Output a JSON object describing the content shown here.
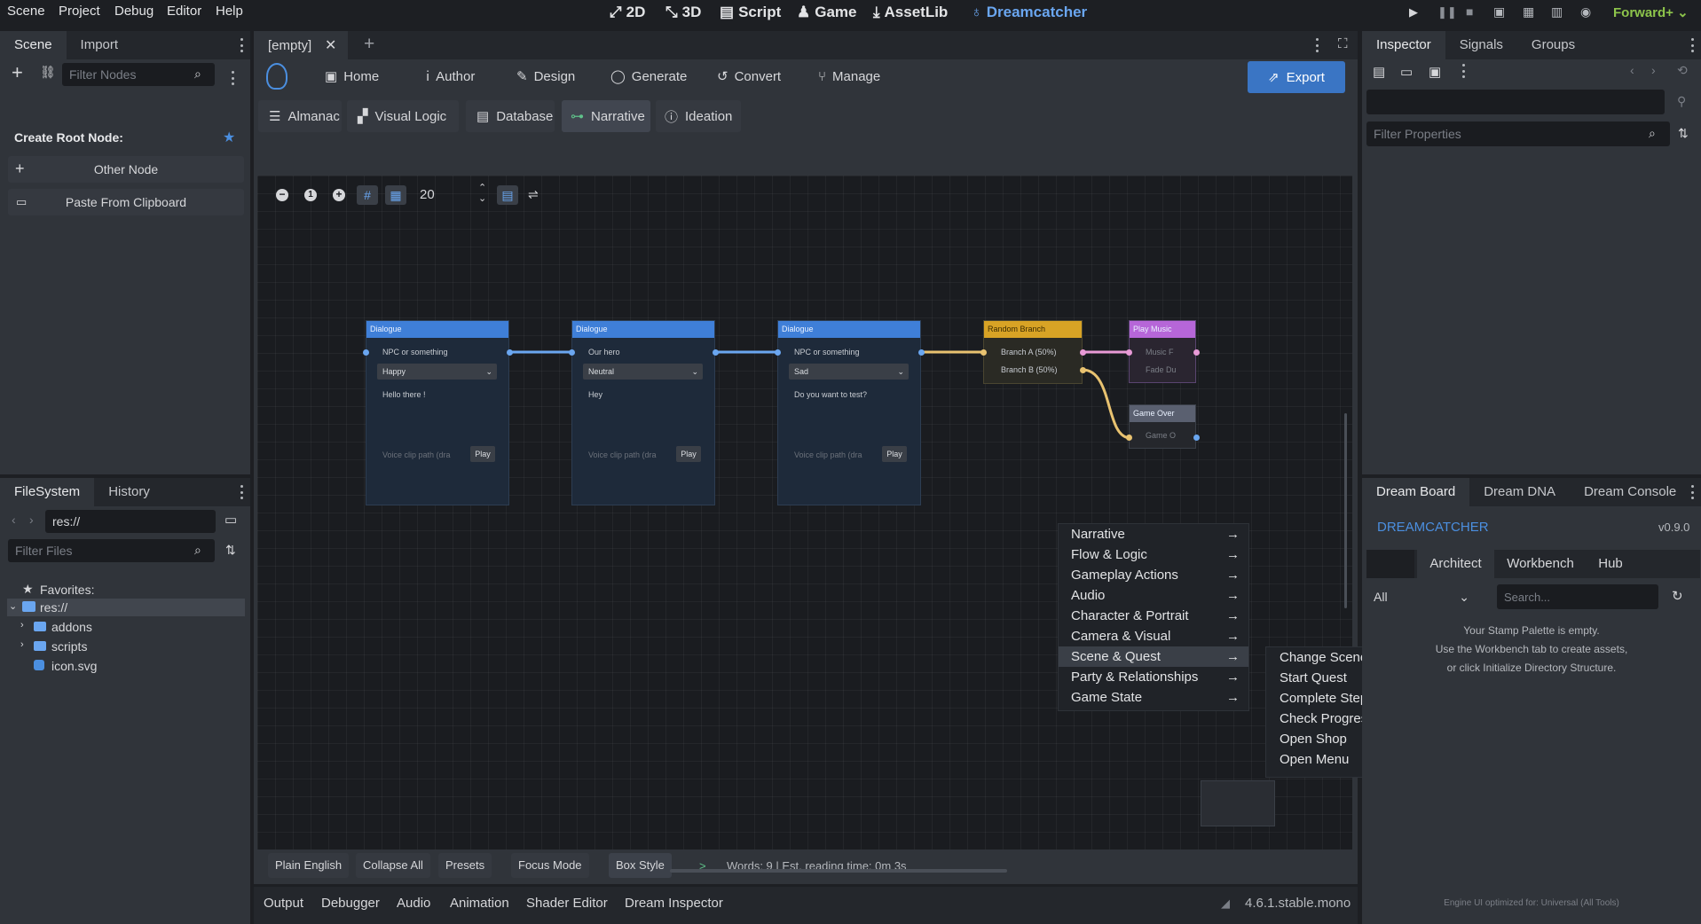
{
  "menu": [
    "Scene",
    "Project",
    "Debug",
    "Editor",
    "Help"
  ],
  "workspaces": {
    "w2d": "2D",
    "w3d": "3D",
    "script": "Script",
    "game": "Game",
    "assetlib": "AssetLib",
    "dreamcatcher": "Dreamcatcher"
  },
  "renderer": "Forward+",
  "scene_dock": {
    "tabs": [
      "Scene",
      "Import"
    ],
    "filter_placeholder": "Filter Nodes",
    "create_root": "Create Root Node:",
    "other_node": "Other Node",
    "paste": "Paste From Clipboard"
  },
  "filesystem": {
    "tabs": [
      "FileSystem",
      "History"
    ],
    "path": "res://",
    "filter_placeholder": "Filter Files",
    "favorites": "Favorites:",
    "root": "res://",
    "items": [
      "addons",
      "scripts",
      "icon.svg"
    ]
  },
  "editor_tab": {
    "name": "[empty]"
  },
  "toolbar": {
    "home": "Home",
    "author": "Author",
    "design": "Design",
    "generate": "Generate",
    "convert": "Convert",
    "manage": "Manage",
    "export": "Export"
  },
  "subtabs": {
    "almanac": "Almanac",
    "visual_logic": "Visual Logic",
    "database": "Database",
    "narrative": "Narrative",
    "ideation": "Ideation"
  },
  "graph": {
    "zoom": "20",
    "dialogues": [
      {
        "title": "Dialogue",
        "speaker": "NPC or something",
        "emotion": "Happy",
        "text": "Hello there !",
        "voice": "Voice clip path (dra",
        "play": "Play"
      },
      {
        "title": "Dialogue",
        "speaker": "Our hero",
        "emotion": "Neutral",
        "text": "Hey",
        "voice": "Voice clip path (dra",
        "play": "Play"
      },
      {
        "title": "Dialogue",
        "speaker": "NPC or something",
        "emotion": "Sad",
        "text": "Do you want to test?",
        "voice": "Voice clip path (dra",
        "play": "Play"
      }
    ],
    "random_branch": {
      "title": "Random Branch",
      "a": "Branch A (50%)",
      "b": "Branch B (50%)"
    },
    "play_music": {
      "title": "Play Music",
      "l1": "Music F",
      "l2": "Fade Du"
    },
    "game_over": {
      "title": "Game Over",
      "l1": "Game O"
    }
  },
  "context_menu": {
    "items": [
      "Narrative",
      "Flow & Logic",
      "Gameplay Actions",
      "Audio",
      "Character & Portrait",
      "Camera & Visual",
      "Scene & Quest",
      "Party & Relationships",
      "Game State"
    ],
    "submenu": [
      "Change Scene",
      "Start Quest",
      "Complete Step",
      "Check Progress",
      "Open Shop",
      "Open Menu"
    ]
  },
  "bottom_buttons": {
    "plain": "Plain English",
    "collapse": "Collapse All",
    "presets": "Presets",
    "focus": "Focus Mode",
    "box": "Box Style"
  },
  "status": {
    "prompt": ">",
    "words": "Words: 9 | Est. reading time: 0m 3s"
  },
  "bottom_tabs": [
    "Output",
    "Debugger",
    "Audio",
    "Animation",
    "Shader Editor",
    "Dream Inspector"
  ],
  "version": "4.6.1.stable.mono",
  "inspector": {
    "tabs": [
      "Inspector",
      "Signals",
      "Groups"
    ],
    "filter_placeholder": "Filter Properties"
  },
  "dream": {
    "tabs": [
      "Dream Board",
      "Dream DNA",
      "Dream Console"
    ],
    "title": "DREAMCATCHER",
    "version": "v0.9.0",
    "subtabs": [
      "Architect",
      "Workbench",
      "Hub"
    ],
    "filter": "All",
    "search_placeholder": "Search...",
    "empty1": "Your Stamp Palette is empty.",
    "empty2": "Use the Workbench tab to create assets,",
    "empty3": "or click Initialize Directory Structure.",
    "footer": "Engine UI optimized for: Universal (All Tools)"
  },
  "colors": {
    "accent": "#4b8fe0",
    "dialogue_header": "#3f7fd8",
    "branch_header": "#d8a325",
    "music_header": "#b666d8",
    "gameover_header": "#5a6070",
    "link": "#6aa6f0",
    "branch_link": "#e8c270",
    "music_link": "#e89ad6"
  }
}
